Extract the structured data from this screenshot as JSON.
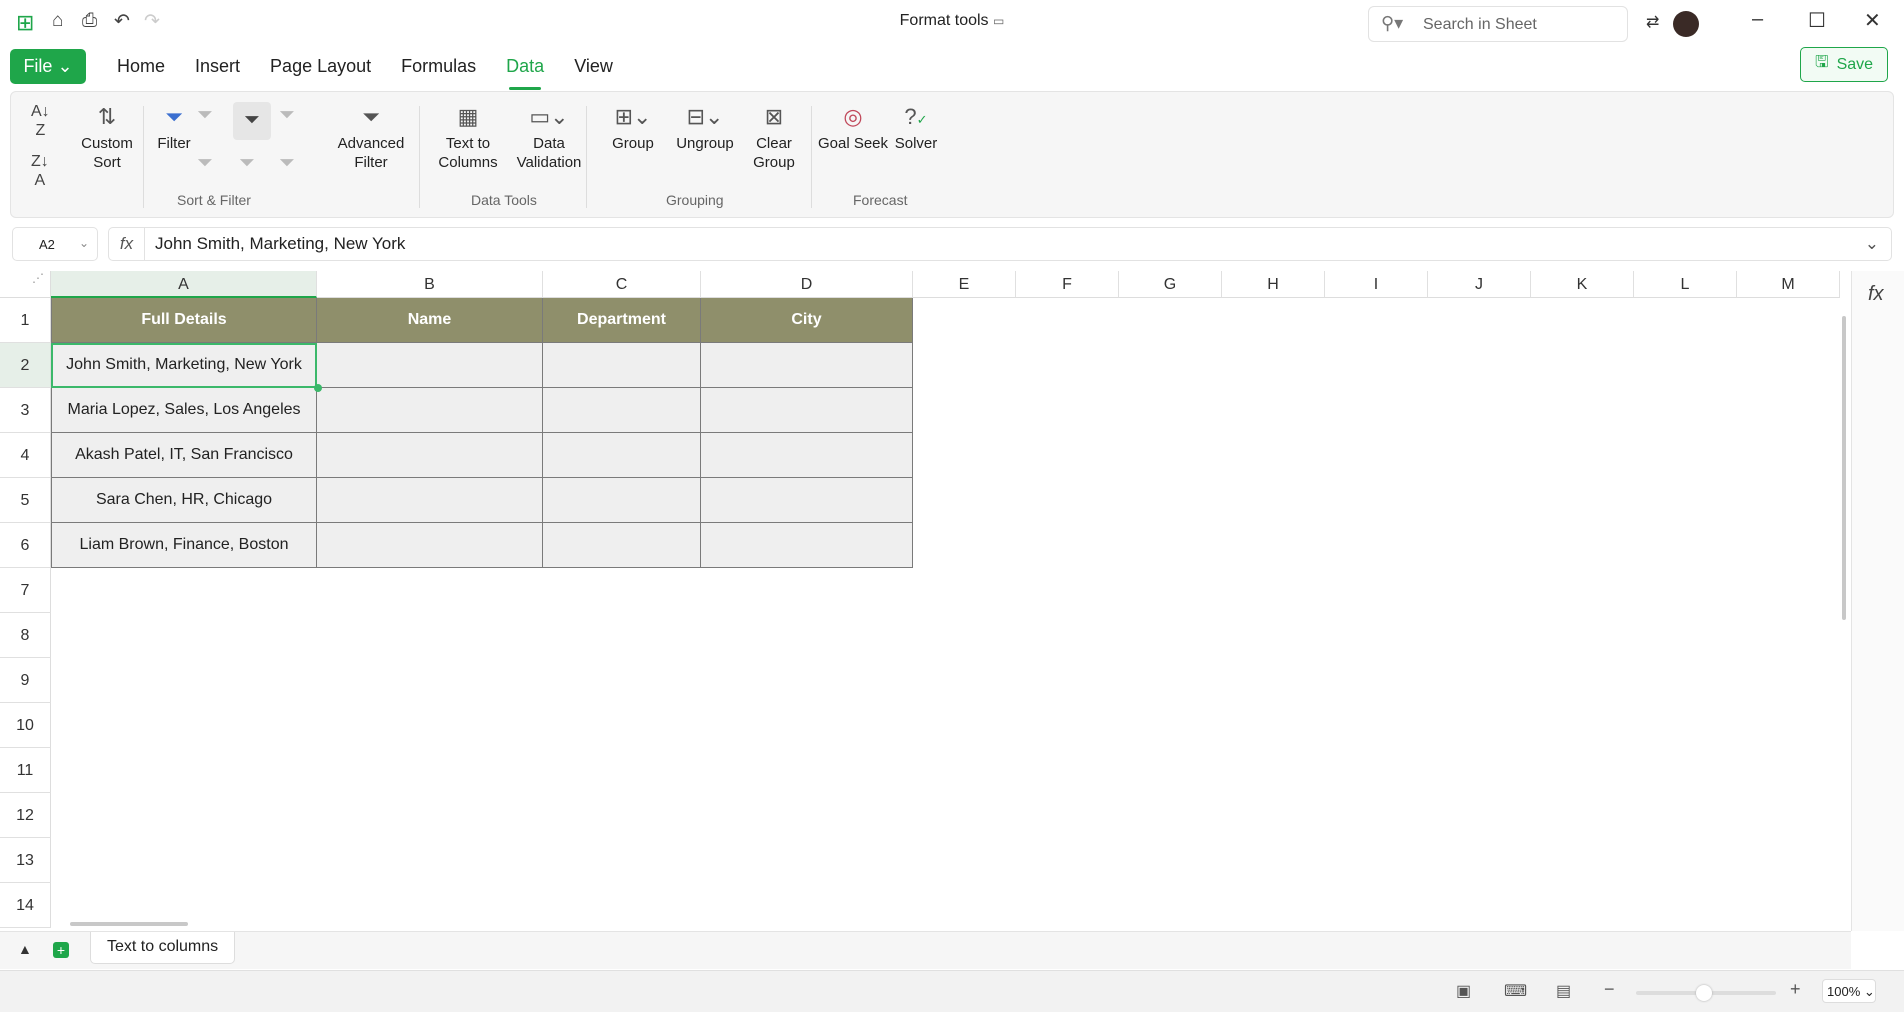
{
  "app": {
    "title": "Format tools"
  },
  "search": {
    "placeholder": "Search in Sheet"
  },
  "menu": {
    "file": "File",
    "tabs": [
      "Home",
      "Insert",
      "Page Layout",
      "Formulas",
      "Data",
      "View"
    ],
    "active": "Data"
  },
  "save_label": "Save",
  "ribbon": {
    "custom_sort": "Custom Sort",
    "filter": "Filter",
    "advanced_filter": "Advanced Filter",
    "sort_filter_group": "Sort & Filter",
    "text_to_columns": "Text to Columns",
    "data_validation": "Data Validation",
    "data_tools_group": "Data Tools",
    "group": "Group",
    "ungroup": "Ungroup",
    "clear_group": "Clear Group",
    "grouping_group": "Grouping",
    "goal_seek": "Goal Seek",
    "solver": "Solver",
    "forecast_group": "Forecast"
  },
  "formula_bar": {
    "cell_ref": "A2",
    "value": "John Smith, Marketing, New York"
  },
  "columns": [
    "A",
    "B",
    "C",
    "D",
    "E",
    "F",
    "G",
    "H",
    "I",
    "J",
    "K",
    "L",
    "M"
  ],
  "rows": [
    "1",
    "2",
    "3",
    "4",
    "5",
    "6",
    "7",
    "8",
    "9",
    "10",
    "11",
    "12",
    "13",
    "14"
  ],
  "table": {
    "headers": [
      "Full Details",
      "Name",
      "Department",
      "City"
    ],
    "rows": [
      [
        "John Smith, Marketing, New York",
        "",
        "",
        ""
      ],
      [
        "Maria Lopez, Sales, Los Angeles",
        "",
        "",
        ""
      ],
      [
        "Akash Patel, IT, San Francisco",
        "",
        "",
        ""
      ],
      [
        "Sara Chen, HR, Chicago",
        "",
        "",
        ""
      ],
      [
        "Liam Brown, Finance, Boston",
        "",
        "",
        ""
      ]
    ]
  },
  "sheet_tab": "Text to columns",
  "zoom": {
    "label": "100%",
    "value": 100
  },
  "colors": {
    "accent": "#1fa64a",
    "header_fill": "#8f8f6b"
  }
}
